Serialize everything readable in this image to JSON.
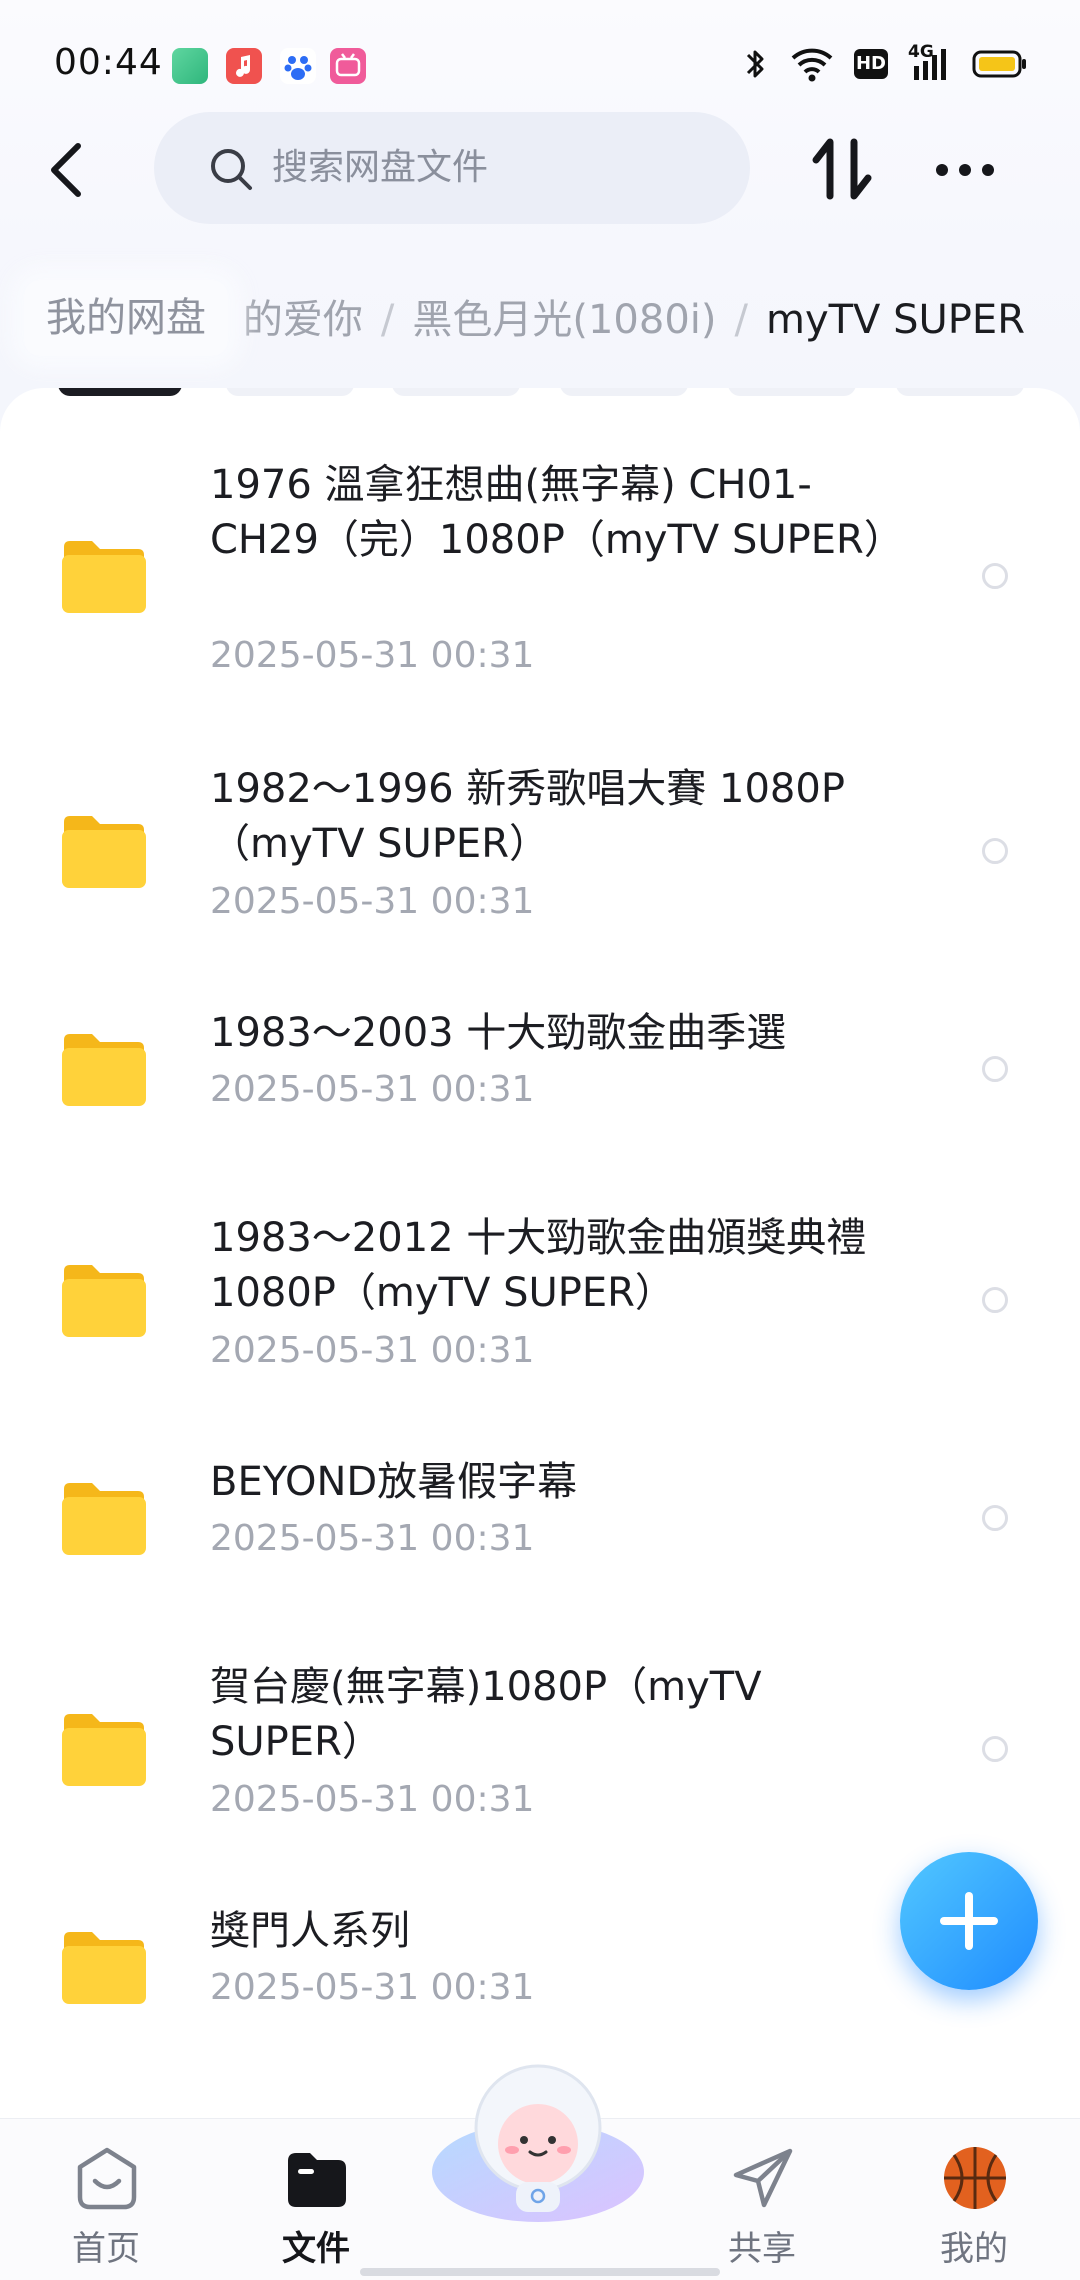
{
  "status_bar": {
    "time": "00:44",
    "network_badge": "4G",
    "hd_badge": "HD",
    "battery_color": "#f5c518"
  },
  "header": {
    "search_placeholder": "搜索网盘文件",
    "back_icon": "chevron-left-icon",
    "sort_icon": "sort-icon",
    "more_icon": "more-icon"
  },
  "breadcrumb": {
    "root": "我的网盘",
    "partial": "的爱你",
    "middle": "黑色月光(1080i)",
    "current": "myTV SUPER",
    "separator": "/"
  },
  "files": [
    {
      "name": "1976 溫拿狂想曲(無字幕) CH01-CH29（完）1080P（myTV SUPER）",
      "date": "2025-05-31",
      "time": "00:31"
    },
    {
      "name": "1982～1996 新秀歌唱大賽 1080P（myTV SUPER）",
      "date": "2025-05-31",
      "time": "00:31"
    },
    {
      "name": "1983～2003 十大勁歌金曲季選",
      "date": "2025-05-31",
      "time": "00:31"
    },
    {
      "name": "1983～2012 十大勁歌金曲頒獎典禮 1080P（myTV SUPER）",
      "date": "2025-05-31",
      "time": "00:31"
    },
    {
      "name": "BEYOND放暑假字幕",
      "date": "2025-05-31",
      "time": "00:31"
    },
    {
      "name": "賀台慶(無字幕)1080P（myTV SUPER）",
      "date": "2025-05-31",
      "time": "00:31"
    },
    {
      "name": "獎門人系列",
      "date": "2025-05-31",
      "time": "00:31"
    }
  ],
  "fab": {
    "icon": "plus-icon",
    "color": "#2a9dff"
  },
  "bottom_nav": {
    "items": [
      {
        "label": "首页",
        "icon": "home-icon",
        "active": false
      },
      {
        "label": "文件",
        "icon": "folder-icon",
        "active": true
      },
      {
        "label": "共享",
        "icon": "send-icon",
        "active": false
      },
      {
        "label": "我的",
        "icon": "basketball-avatar-icon",
        "active": false
      }
    ]
  },
  "colors": {
    "folder": "#ffd23a",
    "accent": "#2a9dff",
    "text": "#1c1d22",
    "muted": "#a4a8b2"
  }
}
